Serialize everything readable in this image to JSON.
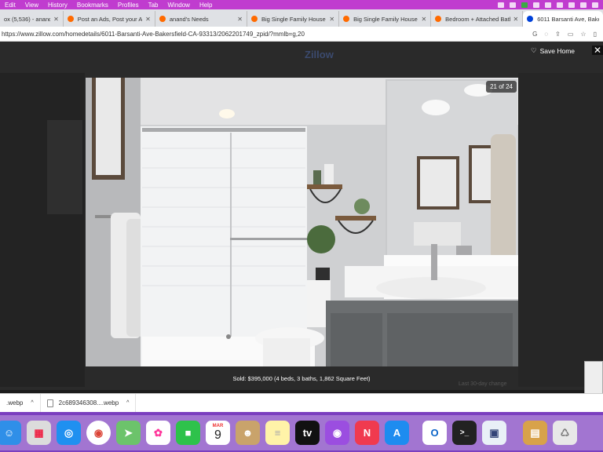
{
  "menubar": {
    "items": [
      "Edit",
      "View",
      "History",
      "Bookmarks",
      "Profiles",
      "Tab",
      "Window",
      "Help"
    ]
  },
  "tabs": [
    {
      "label": "ox (5,536) - anand.nsit@",
      "color": "#e8eaed"
    },
    {
      "label": "Post an Ads, Post your Ads",
      "color": "#ff6a00"
    },
    {
      "label": "anand's Needs",
      "color": "#ff6a00"
    },
    {
      "label": "Big Single Family House For",
      "color": "#ff6a00"
    },
    {
      "label": "Big Single Family House For",
      "color": "#ff6a00"
    },
    {
      "label": "Bedroom + Attached Bathro",
      "color": "#ff6a00"
    },
    {
      "label": "6011 Barsanti Ave, Bakersfie",
      "color": "#0041d9"
    }
  ],
  "url": "https://www.zillow.com/homedetails/6011-Barsanti-Ave-Bakersfield-CA-93313/2062201749_zpid/?mmlb=g,20",
  "page": {
    "logo": "Zillow",
    "save_home": "Save Home",
    "close": "✕",
    "counter": "21 of 24",
    "caption": "Sold: $395,000 (4 beds, 3 baths, 1,862 Square Feet)",
    "bg_right_text": "Last 30-day change"
  },
  "downloads": [
    {
      "name": ".webp"
    },
    {
      "name": "2c689346308....webp"
    }
  ],
  "dock": {
    "calendar_month": "MAR",
    "calendar_day": "9",
    "icons": [
      "finder-icon",
      "launchpad-icon",
      "safari-icon",
      "chrome-icon",
      "maps-icon",
      "photos-icon",
      "facetime-icon",
      "calendar-icon",
      "contacts-icon",
      "notes-icon",
      "apple-tv-icon",
      "podcasts-icon",
      "news-icon",
      "app-store-icon",
      "outlook-icon",
      "terminal-icon",
      "preview-icon",
      "archive-utility-icon",
      "trash-icon"
    ]
  }
}
